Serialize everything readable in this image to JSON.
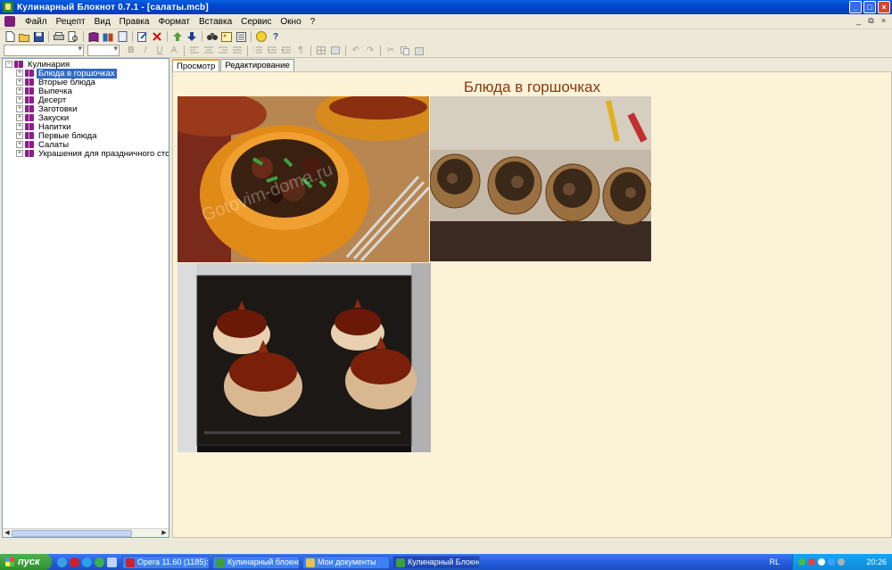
{
  "window": {
    "title": "Кулинарный Блокнот 0.7.1 - [салаты.mcb]",
    "controls": {
      "minimize": "_",
      "maximize": "□",
      "close": "×"
    }
  },
  "menu": [
    "Файл",
    "Рецепт",
    "Вид",
    "Правка",
    "Формат",
    "Вставка",
    "Сервис",
    "Окно",
    "?"
  ],
  "mdi_controls": {
    "minimize": "_",
    "restore": "⧉",
    "close": "×"
  },
  "toolbar2_glyphs": {
    "bold": "B",
    "italic": "I",
    "underline": "U",
    "color": "A"
  },
  "tree": {
    "root": "Кулинария",
    "items": [
      {
        "label": "Блюда в горшочках",
        "selected": true
      },
      {
        "label": "Вторые блюда"
      },
      {
        "label": "Выпечка"
      },
      {
        "label": "Десерт"
      },
      {
        "label": "Заготовки"
      },
      {
        "label": "Закуски"
      },
      {
        "label": "Напитки"
      },
      {
        "label": "Первые блюда"
      },
      {
        "label": "Салаты"
      },
      {
        "label": "Украшения для праздничного стола"
      }
    ]
  },
  "tabs": [
    {
      "label": "Просмотр",
      "active": true
    },
    {
      "label": "Редактирование"
    }
  ],
  "content": {
    "heading": "Блюда в горшочках",
    "photo_watermark": "Gotovim-doma.ru",
    "heading_color": "#8a3a0e",
    "background_color": "#fbf2d8"
  },
  "taskbar": {
    "start_label": "пуск",
    "tasks": [
      {
        "label": "Opera 11.60 (1185): ...",
        "color": "#d0202a"
      },
      {
        "label": "Кулинарный блокно...",
        "color": "#3aa03a"
      },
      {
        "label": "Мои документы",
        "color": "#e8c24a"
      },
      {
        "label": "Кулинарный Блокнот...",
        "color": "#3aa03a",
        "active": true
      }
    ],
    "language": "RL",
    "clock": "20:26"
  }
}
